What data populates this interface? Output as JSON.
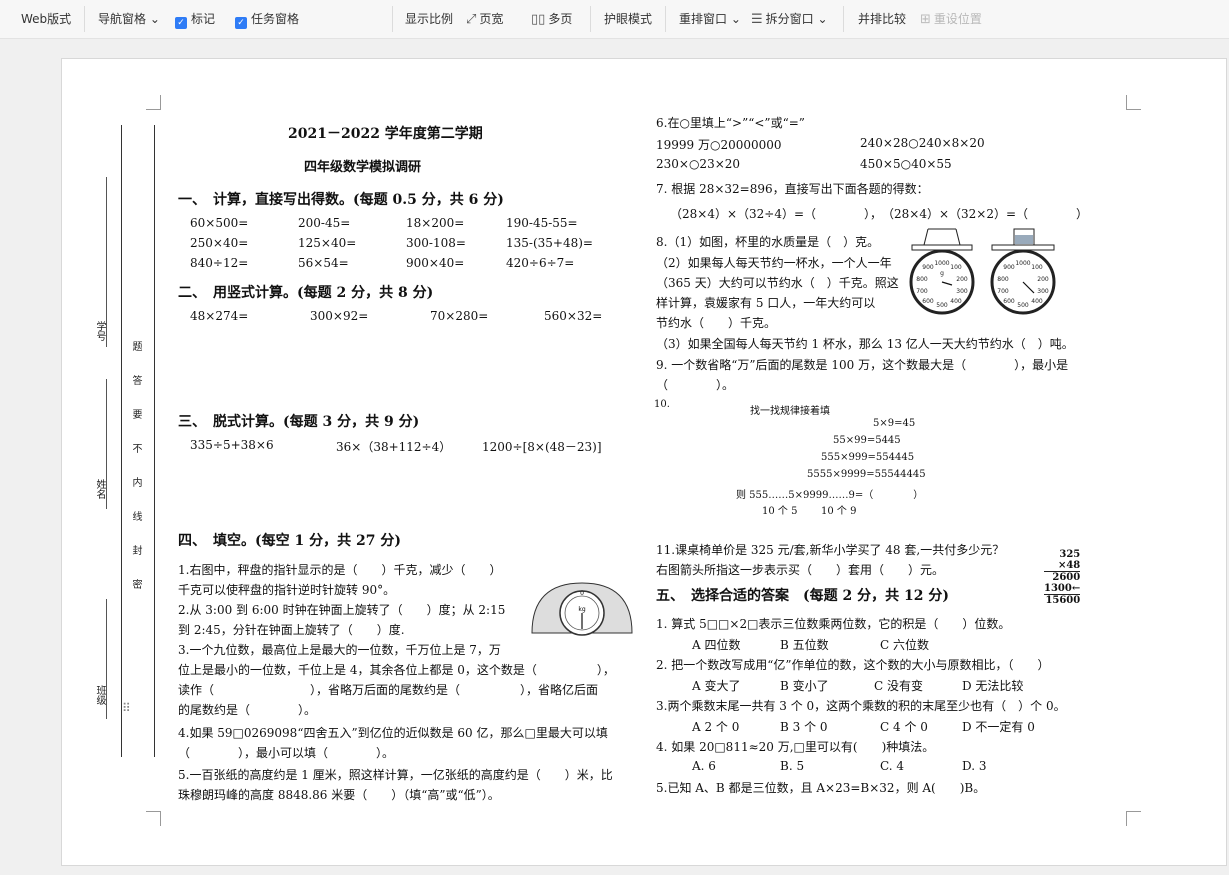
{
  "toolbar": {
    "items": [
      "Web版式",
      "导航窗格",
      "标记",
      "任务窗格",
      "显示比例",
      "页宽",
      "多页",
      "护眼模式",
      "重排窗口",
      "拆分窗口",
      "并排比较",
      "重设位置"
    ]
  },
  "doc": {
    "title": "2021－2022 学年度第二学期",
    "subtitle": "四年级数学模拟调研",
    "binding": {
      "school_id": "学号",
      "name": "姓名",
      "class": "班级",
      "warn": [
        "题",
        "答",
        "要",
        "不",
        "内",
        "线",
        "封",
        "密"
      ]
    },
    "s1": {
      "head": "一、　计算，直接写出得数。(每题 0.5 分，共 6 分)",
      "rows": [
        [
          "60×500=",
          "200-45=",
          "18×200=",
          "190-45-55="
        ],
        [
          "250×40=",
          "125×40=",
          "300-108=",
          "135-(35+48)="
        ],
        [
          "840÷12=",
          "56×54=",
          "900×40=",
          "420÷6÷7="
        ]
      ]
    },
    "s2": {
      "head": "二、　用竖式计算。(每题 2 分，共 8 分)",
      "items": [
        "48×274=",
        "300×92=",
        "70×280=",
        "560×32="
      ]
    },
    "s3": {
      "head": "三、　脱式计算。(每题 3 分，共 9 分)",
      "items": [
        "335÷5+38×6",
        "36×（38+112÷4）",
        "1200÷[8×(48－23)]"
      ]
    },
    "s4": {
      "head": "四、　填空。(每空 1 分，共 27 分)",
      "lines": [
        "1.右图中，秤盘的指针显示的是（　　）千克，减少（　　）",
        "千克可以使秤盘的指针逆时针旋转 90°。",
        "2.从 3:00 到 6:00 时钟在钟面上旋转了（　　）度；从 2:15",
        "到 2:45，分针在钟面上旋转了（　　）度.",
        "3.一个九位数，最高位上是最大的一位数，千万位上是 7，万",
        "位上是最小的一位数，千位上是 4，其余各位上都是 0，这个数是（　　　　　），",
        "读作（　　　　　　　　），省略万后面的尾数约是（　　　　　），省略亿后面",
        "的尾数约是（　　　　）。",
        "4.如果 59□0269098“四舍五入”到亿位的近似数是 60 亿，那么□里最大可以填",
        "（　　　　），最小可以填（　　　　）。",
        "5.一百张纸的高度约是 1 厘米，照这样计算，一亿张纸的高度约是（　　）米，比",
        "珠穆朗玛峰的高度 8848.86 米要（　　）（填“高”或“低”）。"
      ],
      "scale_label": "kg"
    },
    "q6": {
      "head": "6.在○里填上“>”“<”或“=”",
      "a": "19999 万○20000000",
      "b": "240×28○240×8×20",
      "c": "230×○23×20",
      "d": "450×5○40×55"
    },
    "q7": {
      "head": "7.  根据 28×32=896，直接写出下面各题的得数：",
      "line": "（28×4）×（32÷4）=（　　　　），　（28×4）×（32×2）=（　　　　）"
    },
    "q8": {
      "lines": [
        "8.（1）如图，杯里的水质量是（　）克。",
        "（2）如果每人每天节约一杯水，一个人一年",
        "（365 天）大约可以节约水（　）千克。照这",
        "样计算，袁媛家有 5 口人，一年大约可以",
        "节约水（　　）千克。",
        "（3）如果全国每人每天节约 1 杯水，那么 13 亿人一天大约节约水（　）吨。"
      ],
      "dial1": [
        "1000",
        "100",
        "900",
        "200",
        "800",
        "300",
        "700",
        "400",
        "600",
        "500",
        "g"
      ],
      "dial2": [
        "1000",
        "100",
        "900",
        "200",
        "800",
        "300",
        "700",
        "400",
        "600",
        "500"
      ]
    },
    "q9": {
      "line": "9.  一个数省略“万”后面的尾数是 100 万，这个数最大是（　　　　），最小是",
      "line2": "（　　　　）。"
    },
    "q10": {
      "num": "10.",
      "head": "找一找规律接着填",
      "rows": [
        "5×9=45",
        "55×99=5445",
        "555×999=554445",
        "5555×9999=55544445"
      ],
      "last": "则 555……5×9999……9=（　　　　）",
      "under": [
        "10 个 5",
        "10 个 9"
      ]
    },
    "q11": {
      "line": "11.课桌椅单价是 325 元/套,新华小学买了 48 套,一共付多少元？",
      "line2": "右图箭头所指这一步表示买（　　）套用（　　）元。",
      "calc": [
        "325",
        "×48",
        "2600",
        "1300",
        "15600"
      ]
    },
    "s5": {
      "head": "五、　选择合适的答案　(每题 2 分，共 12 分)",
      "qs": [
        {
          "q": "1. 算式 5□□×2□表示三位数乘两位数，它的积是（　　）位数。",
          "opts": [
            "A 四位数",
            "B 五位数",
            "C 六位数"
          ]
        },
        {
          "q": "2. 把一个数改写成用“亿”作单位的数，这个数的大小与原数相比，（　　）",
          "opts": [
            "A 变大了",
            "B 变小了",
            "C 没有变",
            "D 无法比较"
          ]
        },
        {
          "q": "3.两个乘数末尾一共有 3 个 0，这两个乘数的积的末尾至少也有（　）个 0。",
          "opts": [
            "A 2 个 0",
            "B 3 个 0",
            "C 4 个 0",
            "D 不一定有 0"
          ]
        },
        {
          "q": "4.  如果 20□811≈20 万,□里可以有(　　)种填法。",
          "opts": [
            "A. 6",
            "B. 5",
            "C. 4",
            "D. 3"
          ]
        },
        {
          "q": "5.已知 A、B 都是三位数，且 A×23=B×32，则 A(　　)B。",
          "opts": []
        }
      ]
    }
  }
}
